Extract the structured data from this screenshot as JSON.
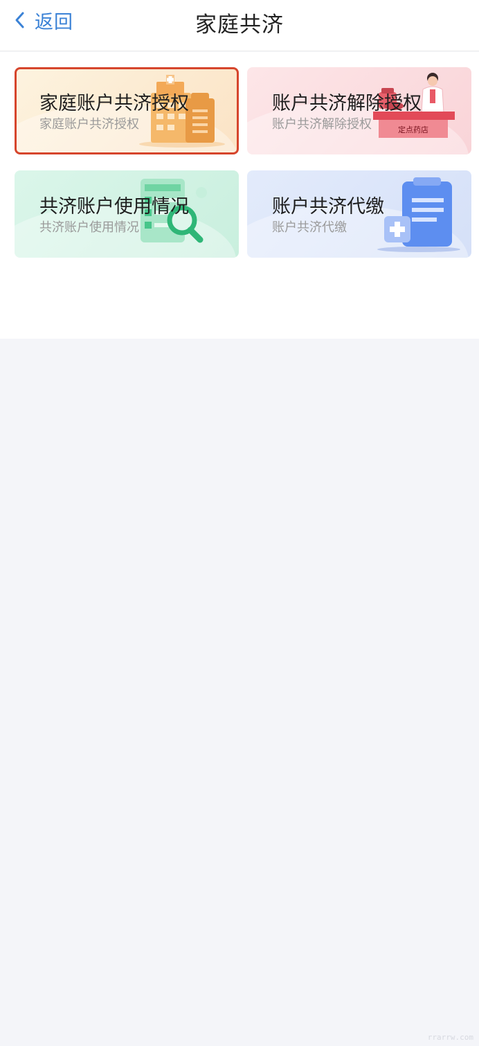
{
  "header": {
    "back_label": "返回",
    "title": "家庭共济"
  },
  "cards": [
    {
      "title": "家庭账户共济授权",
      "subtitle": "家庭账户共济授权",
      "icon": "hospital-building-icon",
      "highlighted": true
    },
    {
      "title": "账户共济解除授权",
      "subtitle": "账户共济解除授权",
      "icon": "pharmacy-doctor-icon",
      "badge": "定点药店"
    },
    {
      "title": "共济账户使用情况",
      "subtitle": "共济账户使用情况",
      "icon": "document-search-icon"
    },
    {
      "title": "账户共济代缴",
      "subtitle": "账户共济代缴",
      "icon": "medical-clipboard-icon"
    }
  ],
  "colors": {
    "accent": "#3b82d6",
    "highlight_border": "#d6452c"
  },
  "watermark": "rrarrw.com"
}
